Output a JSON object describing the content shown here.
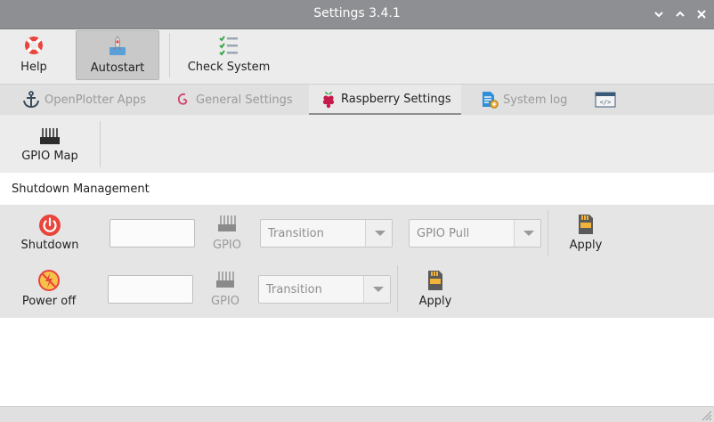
{
  "window": {
    "title": "Settings 3.4.1"
  },
  "toolbar": {
    "help_label": "Help",
    "autostart_label": "Autostart",
    "check_system_label": "Check System"
  },
  "tabs": [
    {
      "label": "OpenPlotter Apps",
      "icon": "anchor-icon",
      "active": false
    },
    {
      "label": "General Settings",
      "icon": "debian-swirl-icon",
      "active": false
    },
    {
      "label": "Raspberry Settings",
      "icon": "raspberry-icon",
      "active": true
    },
    {
      "label": "System log",
      "icon": "log-file-icon",
      "active": false
    },
    {
      "label": "",
      "icon": "code-window-icon",
      "active": false
    }
  ],
  "subtoolbar": {
    "gpio_map_label": "GPIO Map"
  },
  "section": {
    "title": "Shutdown Management"
  },
  "shutdown_row": {
    "label": "Shutdown",
    "gpio_value": "",
    "gpio_label": "GPIO",
    "transition_value": "Transition",
    "pull_value": "GPIO Pull",
    "apply_label": "Apply"
  },
  "poweroff_row": {
    "label": "Power off",
    "gpio_value": "",
    "gpio_label": "GPIO",
    "transition_value": "Transition",
    "apply_label": "Apply"
  },
  "colors": {
    "titlebar": "#8d8f92",
    "shutdown_red": "#e8463c",
    "poweroff_yellow": "#f5c24a",
    "raspberry_red": "#c51a4a"
  }
}
